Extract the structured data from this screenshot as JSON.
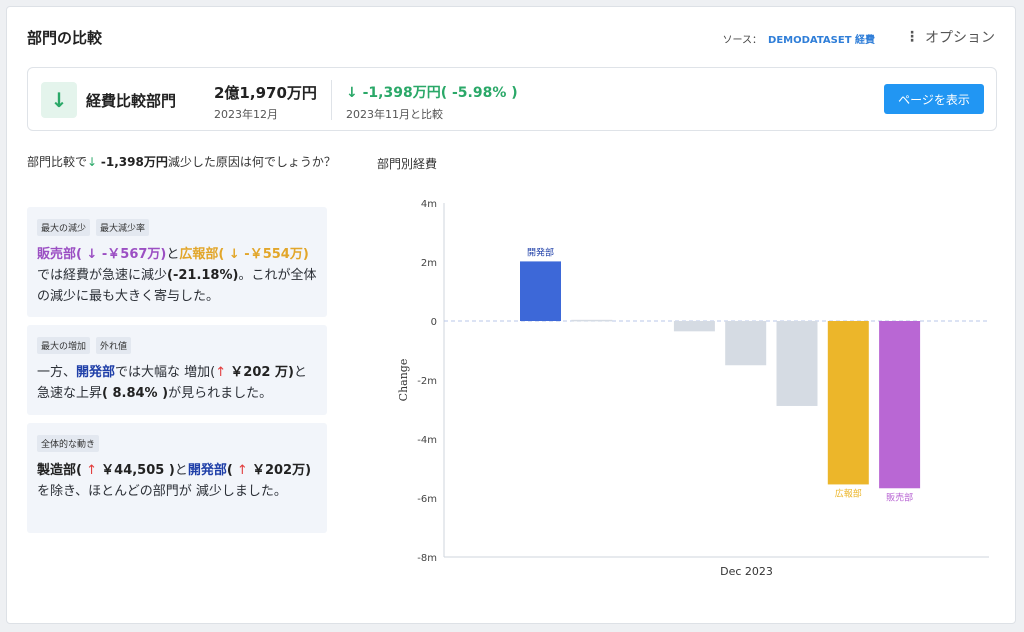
{
  "header": {
    "title": "部門の比較",
    "source_label": "ソース：",
    "source_name": "DEMODATASET 経費",
    "options_label": "オプション"
  },
  "summary": {
    "label": "経費比較部門",
    "amount": "2億1,970万円",
    "period": "2023年12月",
    "change": "↓ -1,398万円( -5.98% )",
    "compare_label": "2023年11月と比較",
    "button_label": "ページを表示"
  },
  "question": {
    "prefix": "部門比較で",
    "arrow": "↓",
    "amount": "-1,398万円",
    "suffix": "減少した原因は何でしょうか？"
  },
  "insights": [
    {
      "tags": [
        "最大の減少",
        "最大減少率"
      ],
      "dept1": "販売部",
      "dept1_detail": "( ↓ -￥567万)",
      "join1": "と",
      "dept2": "広報部",
      "dept2_detail": "( ↓ -￥554万)",
      "text1": "では経費が急速に減少",
      "pct": "(-21.18%)",
      "text2": "。これが全体の減少に最も大きく寄与した。"
    },
    {
      "tags": [
        "最大の増加",
        "外れ値"
      ],
      "text1": "一方、",
      "dept": "開発部",
      "text2": "では大幅な 増加(",
      "arrow": "↑",
      "amount": "￥202 万)",
      "text3": "と急速な上昇",
      "pct": "( 8.84% )",
      "text4": "が見られました。"
    },
    {
      "tags": [
        "全体的な動き"
      ],
      "dept1": "製造部",
      "dept1_detail_a": "(",
      "arrow1": "↑",
      "dept1_amount": "￥44,505 )",
      "join": "と",
      "dept2": "開発部",
      "dept2_detail_a": "(",
      "arrow2": "↑",
      "dept2_amount": "￥202万)",
      "text": "を除き、ほとんどの部門が 減少しました。"
    }
  ],
  "chart_data": {
    "type": "bar",
    "title": "部門別経費",
    "xlabel": "Dec 2023",
    "ylabel": "Change",
    "ylim": [
      -8,
      4
    ],
    "yticks": [
      "4m",
      "2m",
      "0",
      "-2m",
      "-4m",
      "-6m",
      "-8m"
    ],
    "ytick_values": [
      4,
      2,
      0,
      -2,
      -4,
      -6,
      -8
    ],
    "unit": "m",
    "bars": [
      {
        "label": "開発部",
        "value": 2.02,
        "color": "#3d68d8",
        "show_label": true
      },
      {
        "label": "",
        "value": 0.04,
        "color": "#d5dbe3",
        "show_label": false
      },
      {
        "label": "",
        "value": -0.35,
        "color": "#d5dbe3",
        "show_label": false
      },
      {
        "label": "",
        "value": -1.5,
        "color": "#d5dbe3",
        "show_label": false
      },
      {
        "label": "",
        "value": -2.88,
        "color": "#d5dbe3",
        "show_label": false
      },
      {
        "label": "広報部",
        "value": -5.54,
        "color": "#ecb62a",
        "show_label": true
      },
      {
        "label": "販売部",
        "value": -5.67,
        "color": "#b967d4",
        "show_label": true
      }
    ]
  }
}
